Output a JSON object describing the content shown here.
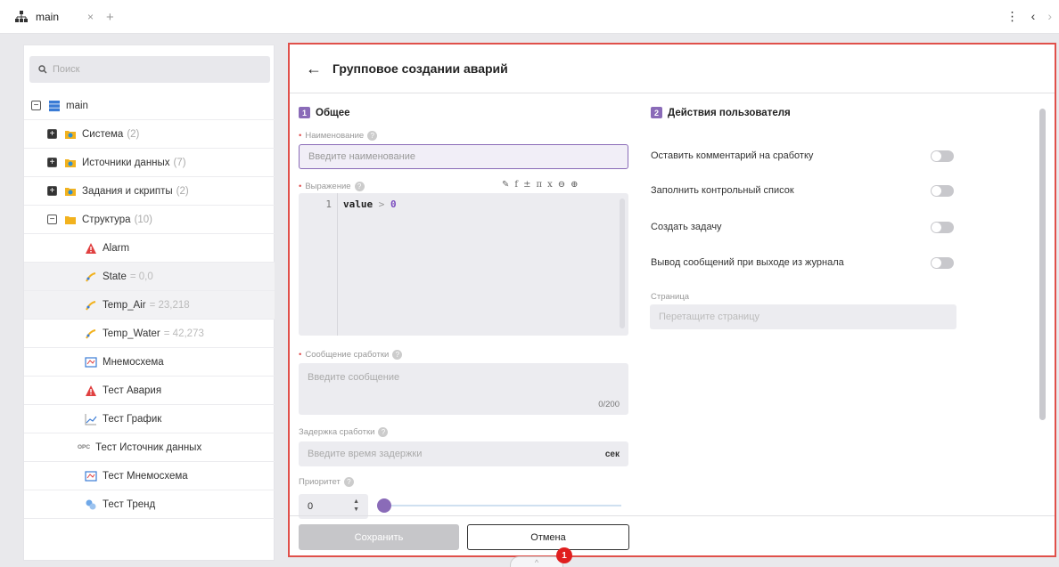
{
  "tab": {
    "label": "main",
    "close": "×",
    "add": "+"
  },
  "topbar": {
    "menu": "⋮",
    "back": "‹",
    "forward": "›"
  },
  "sidebar": {
    "search_placeholder": "Поиск",
    "root": {
      "label": "main"
    },
    "items": [
      {
        "label": "Система",
        "count": "(2)"
      },
      {
        "label": "Источники данных",
        "count": "(7)"
      },
      {
        "label": "Задания и скрипты",
        "count": "(2)"
      },
      {
        "label": "Структура",
        "count": "(10)"
      },
      {
        "label": "Alarm"
      },
      {
        "label": "State",
        "value": "= 0,0"
      },
      {
        "label": "Temp_Air",
        "value": "= 23,218"
      },
      {
        "label": "Temp_Water",
        "value": "= 42,273"
      },
      {
        "label": "Мнемосхема"
      },
      {
        "label": "Тест Авария"
      },
      {
        "label": "Тест График"
      },
      {
        "label": "Тест Источник данных",
        "prefix": "OPC"
      },
      {
        "label": "Тест Мнемосхема"
      },
      {
        "label": "Тест Тренд"
      }
    ]
  },
  "panel": {
    "title": "Групповое создании аварий",
    "back": "←",
    "section1": {
      "num": "1",
      "title": "Общее"
    },
    "section2": {
      "num": "2",
      "title": "Действия пользователя"
    },
    "name": {
      "label": "Наименование",
      "placeholder": "Введите наименование"
    },
    "expression": {
      "label": "Выражение",
      "toolbar": [
        "✎",
        "f",
        "±",
        "π",
        "x",
        "⊖",
        "⊕"
      ],
      "line_number": "1",
      "code_var": "value",
      "code_op": ">",
      "code_num": "0"
    },
    "message": {
      "label": "Сообщение сработки",
      "placeholder": "Введите сообщение",
      "counter": "0/200"
    },
    "delay": {
      "label": "Задержка сработки",
      "placeholder": "Введите время задержки",
      "unit": "сек"
    },
    "priority": {
      "label": "Приоритет",
      "value": "0",
      "slider_level": 0
    },
    "toggles": [
      {
        "label": "Оставить комментарий на сработку",
        "on": false
      },
      {
        "label": "Заполнить контрольный список",
        "on": false
      },
      {
        "label": "Создать задачу",
        "on": false
      },
      {
        "label": "Вывод сообщений при выходе из журнала",
        "on": false
      }
    ],
    "page": {
      "label": "Страница",
      "placeholder": "Перетащите страницу"
    },
    "save": "Сохранить",
    "cancel": "Отмена"
  },
  "badge": "1",
  "collapse": "^",
  "colors": {
    "accent": "#8a6bb8",
    "highlight_border": "#e0504a",
    "badge": "#e01e1e"
  }
}
